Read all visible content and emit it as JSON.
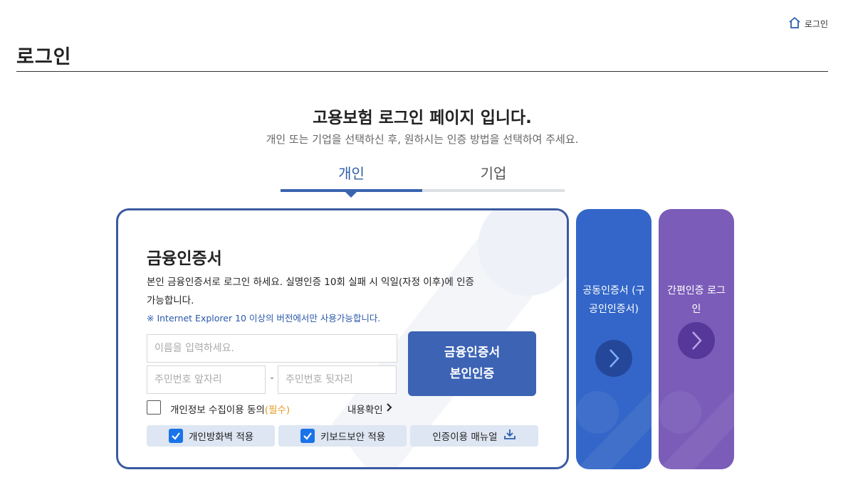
{
  "header": {
    "top_login_label": "로그인",
    "page_title": "로그인"
  },
  "intro": {
    "headline": "고용보험 로그인 페이지 입니다.",
    "subline": "개인 또는 기업을 선택하신 후, 원하시는 인증 방법을 선택하여 주세요."
  },
  "tabs": [
    {
      "label": "개인",
      "active": true
    },
    {
      "label": "기업",
      "active": false
    }
  ],
  "card": {
    "title": "금융인증서",
    "desc": "본인 금융인증서로 로그인 하세요. 실명인증 10회 실패 시 익일(자정 이후)에 인증가능합니다.",
    "note": "※ Internet Explorer 10 이상의 버전에서만 사용가능합니다.",
    "name_placeholder": "이름을 입력하세요.",
    "rrn_front_placeholder": "주민번호 앞자리",
    "rrn_back_placeholder": "주민번호 뒷자리",
    "dash": "-",
    "auth_button_line1": "금융인증서",
    "auth_button_line2": "본인인증",
    "consent_label": "개인정보 수집이용 동의",
    "consent_required": "(필수)",
    "consent_link": "내용확인",
    "options": [
      {
        "label": "개인방화벽 적용",
        "checked": true
      },
      {
        "label": "키보드보안 적용",
        "checked": true
      },
      {
        "label": "인증이용 매뉴얼"
      }
    ]
  },
  "side_buttons": [
    {
      "label": "공동인증서 (구 공인인증서)",
      "color": "#3366c8"
    },
    {
      "label": "간편인증 로그인",
      "color": "#7b5cb8"
    }
  ],
  "colors": {
    "accent": "#3a64b0",
    "required": "#e59a1f",
    "note": "#2a57a8"
  },
  "icons": {
    "home": "home-icon",
    "chevron": "chevron-right-icon",
    "check": "check-icon",
    "download": "download-icon"
  }
}
